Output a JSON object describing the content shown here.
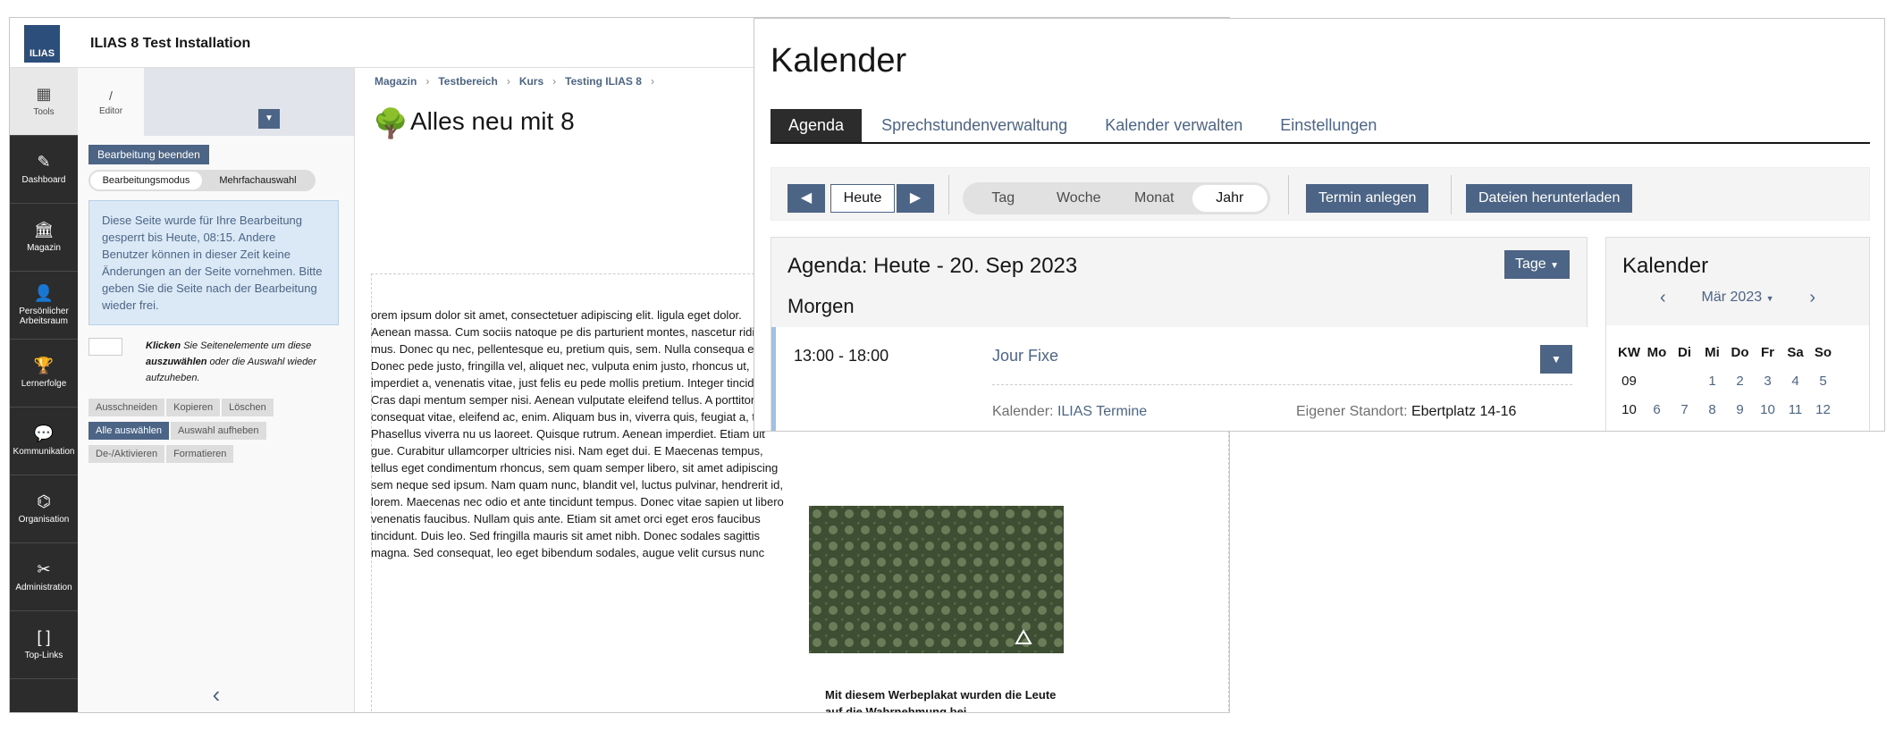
{
  "window1": {
    "app_title": "ILIAS 8 Test Installation",
    "logo_text": "ILIAS",
    "mainbar": [
      {
        "label": "Tools",
        "icon": "grid-icon"
      },
      {
        "label": "Dashboard",
        "icon": "dashboard-icon"
      },
      {
        "label": "Magazin",
        "icon": "bank-icon"
      },
      {
        "label": "Persönlicher Arbeitsraum",
        "icon": "person-icon"
      },
      {
        "label": "Lernerfolge",
        "icon": "trophy-icon"
      },
      {
        "label": "Kommunikation",
        "icon": "chat-icon"
      },
      {
        "label": "Organisation",
        "icon": "org-icon"
      },
      {
        "label": "Administration",
        "icon": "tools-icon"
      },
      {
        "label": "Top-Links",
        "icon": "brackets-icon"
      }
    ],
    "slate": {
      "tab_label": "Editor",
      "tab_icon": "pencil-icon",
      "end_edit_label": "Bearbeitung beenden",
      "mode_edit": "Bearbeitungsmodus",
      "mode_multi": "Mehrfachauswahl",
      "lock_message": "Diese Seite wurde für Ihre Bearbeitung gesperrt bis Heute, 08:15. Andere Benutzer können in dieser Zeit keine Änderungen an der Seite vornehmen. Bitte geben Sie die Seite nach der Bearbeitung wieder frei.",
      "select_hint_bold1": "Klicken",
      "select_hint_mid": " Sie Seitenelemente um diese ",
      "select_hint_bold2": "auszuwählen",
      "select_hint_end": " oder die Auswahl wieder aufzuheben.",
      "buttons_row1": [
        "Ausschneiden",
        "Kopieren",
        "Löschen"
      ],
      "btn_select_all": "Alle auswählen",
      "btn_unselect": "Auswahl aufheben",
      "btn_toggle": "De-/Aktivieren",
      "btn_format": "Formatieren",
      "collapse_icon": "‹"
    },
    "breadcrumb": [
      "Magazin",
      "Testbereich",
      "Kurs",
      "Testing ILIAS 8"
    ],
    "page_title": "Alles neu mit 8",
    "lorem_text": "orem ipsum dolor sit amet, consectetuer adipiscing elit. ligula eget dolor. Aenean massa. Cum sociis natoque pe dis parturient montes, nascetur ridiculus mus. Donec qu nec, pellentesque eu, pretium quis, sem. Nulla consequa enim. Donec pede justo, fringilla vel, aliquet nec, vulputa enim justo, rhoncus ut, imperdiet a, venenatis vitae, just felis eu pede mollis pretium. Integer tincidunt. Cras dapi mentum semper nisi. Aenean vulputate eleifend tellus. A porttitor eu, consequat vitae, eleifend ac, enim. Aliquam bus in, viverra quis, feugiat a, tellus. Phasellus viverra nu us laoreet. Quisque rutrum. Aenean imperdiet. Etiam ult gue. Curabitur ullamcorper ultricies nisi. Nam eget dui. E Maecenas tempus, tellus eget condimentum rhoncus, sem quam semper libero, sit amet adipiscing sem neque sed ipsum. Nam quam nunc, blandit vel, luctus pulvinar, hendrerit id, lorem. Maecenas nec odio et ante tincidunt tempus. Donec vitae sapien ut libero venenatis faucibus. Nullam quis ante. Etiam sit amet orci eget eros faucibus tincidunt. Duis leo. Sed fringilla mauris sit amet nibh. Donec sodales sagittis magna. Sed consequat, leo eget bibendum sodales, augue velit cursus nunc",
    "poster_caption": "Mit diesem Werbeplakat wurden die Leute auf die Wahrnehmung bei Demenzbetroffenen aufmerksam"
  },
  "window2": {
    "title": "Kalender",
    "tabs": [
      "Agenda",
      "Sprechstundenverwaltung",
      "Kalender verwalten",
      "Einstellungen"
    ],
    "active_tab": "Agenda",
    "today_label": "Heute",
    "view_modes": [
      "Tag",
      "Woche",
      "Monat",
      "Jahr"
    ],
    "active_view": "Jahr",
    "btn_new": "Termin anlegen",
    "btn_download": "Dateien herunterladen",
    "agenda_title": "Agenda: Heute - 20. Sep 2023",
    "agenda_range": "Tage",
    "section": "Morgen",
    "event": {
      "time": "13:00 - 18:00",
      "title": "Jour Fixe",
      "calendar_label": "Kalender:",
      "calendar_value": "ILIAS Termine",
      "location_label": "Eigener Standort:",
      "location_value": "Ebertplatz 14-16"
    },
    "mini": {
      "title": "Kalender",
      "month": "Mär 2023",
      "headers": [
        "KW",
        "Mo",
        "Di",
        "Mi",
        "Do",
        "Fr",
        "Sa",
        "So"
      ],
      "rows": [
        [
          "09",
          "",
          "",
          "1",
          "2",
          "3",
          "4",
          "5"
        ],
        [
          "10",
          "6",
          "7",
          "8",
          "9",
          "10",
          "11",
          "12"
        ]
      ]
    }
  },
  "colors": {
    "primary": "#4c6586",
    "mainbar": "#2c2c2c",
    "info_bg": "#dbe9f6",
    "event_accent": "#9ec0ea"
  }
}
